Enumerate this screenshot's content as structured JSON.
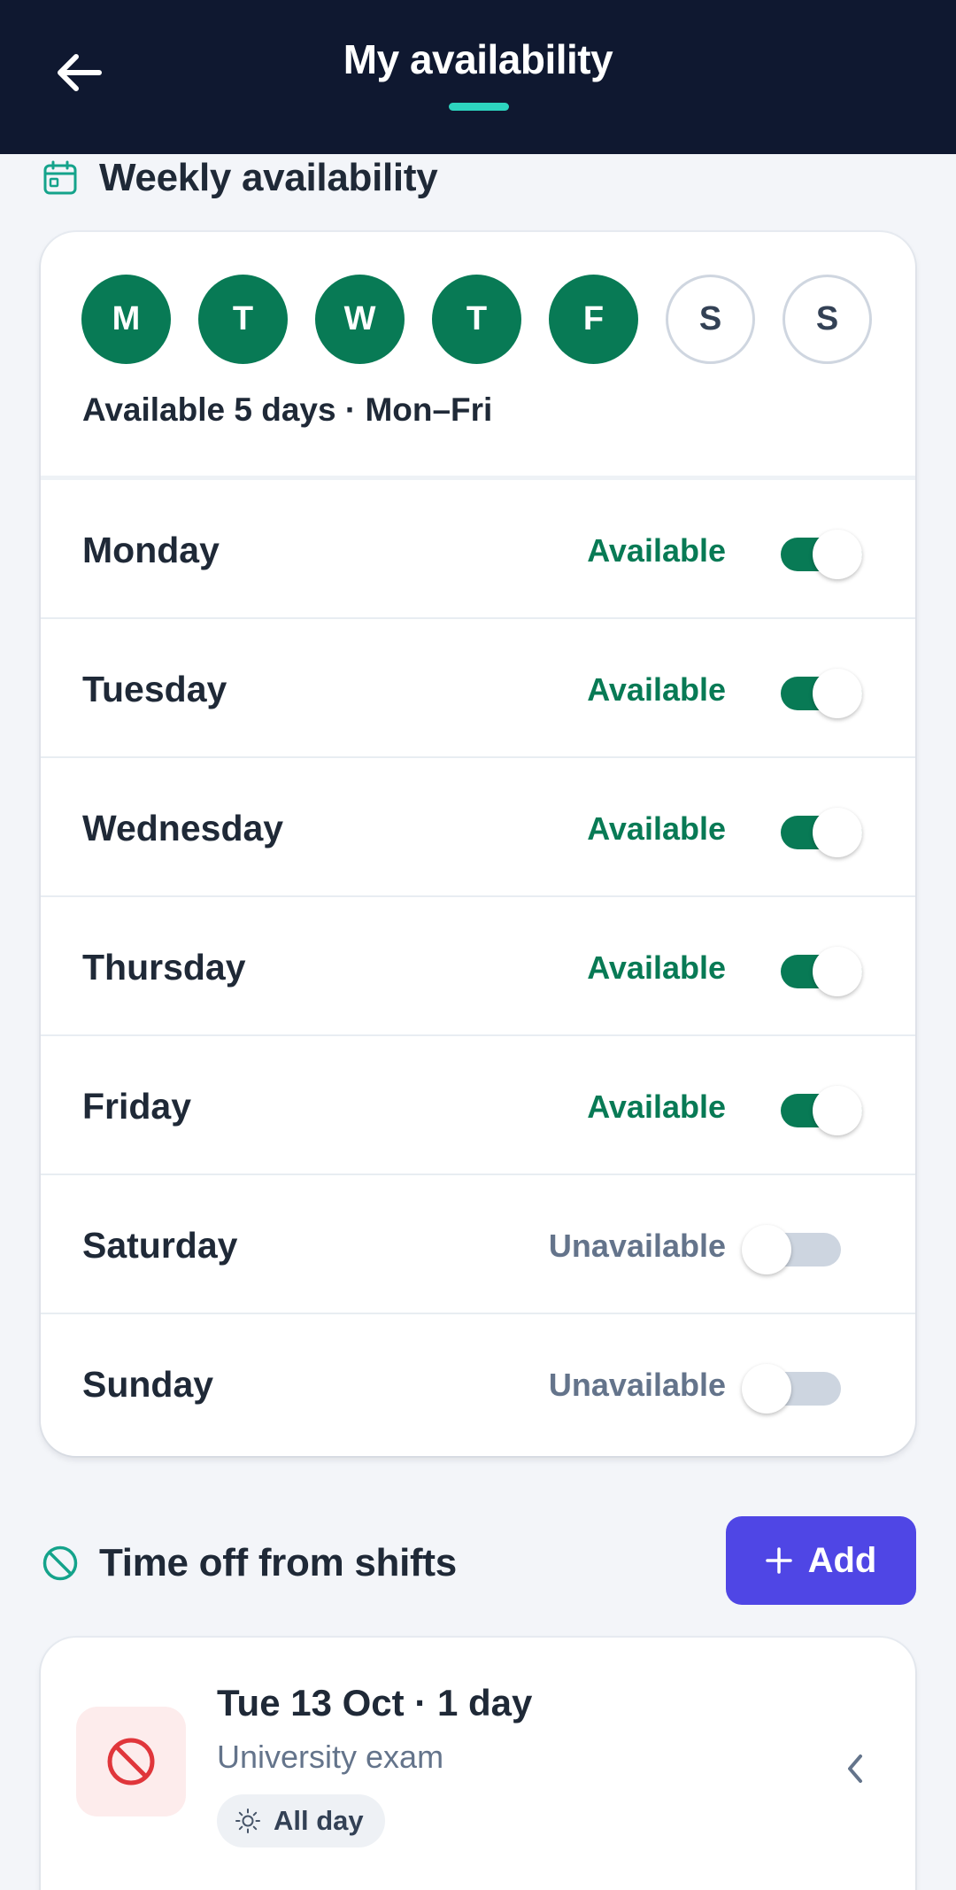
{
  "header": {
    "title": "My availability",
    "back_icon": "arrow-left-icon"
  },
  "weekly": {
    "heading": "Weekly availability",
    "heading_icon": "calendar-icon",
    "circles": [
      {
        "letter": "M",
        "on": true
      },
      {
        "letter": "T",
        "on": true
      },
      {
        "letter": "W",
        "on": true
      },
      {
        "letter": "T",
        "on": true
      },
      {
        "letter": "F",
        "on": true
      },
      {
        "letter": "S",
        "on": false
      },
      {
        "letter": "S",
        "on": false
      }
    ],
    "summary": "Available 5 days · Mon–Fri",
    "days": [
      {
        "name": "Monday",
        "status": "Available",
        "on": true
      },
      {
        "name": "Tuesday",
        "status": "Available",
        "on": true
      },
      {
        "name": "Wednesday",
        "status": "Available",
        "on": true
      },
      {
        "name": "Thursday",
        "status": "Available",
        "on": true
      },
      {
        "name": "Friday",
        "status": "Available",
        "on": true
      },
      {
        "name": "Saturday",
        "status": "Unavailable",
        "on": false
      },
      {
        "name": "Sunday",
        "status": "Unavailable",
        "on": false
      }
    ]
  },
  "time_off": {
    "heading": "Time off from shifts",
    "heading_icon": "prohibited-icon",
    "add_label": "Add",
    "add_icon": "plus-icon",
    "entries": [
      {
        "title": "Tue 13 Oct · 1 day",
        "reason": "University exam",
        "chip": "All day",
        "chip_icon": "sun-icon",
        "icon": "block-icon"
      }
    ]
  },
  "colors": {
    "header_bg": "#0f1830",
    "accent_teal": "#2dd4bf",
    "available_green": "#087a55",
    "unavailable_gray": "#64748b",
    "primary_button": "#4f46e5",
    "danger_red": "#e0363b"
  }
}
